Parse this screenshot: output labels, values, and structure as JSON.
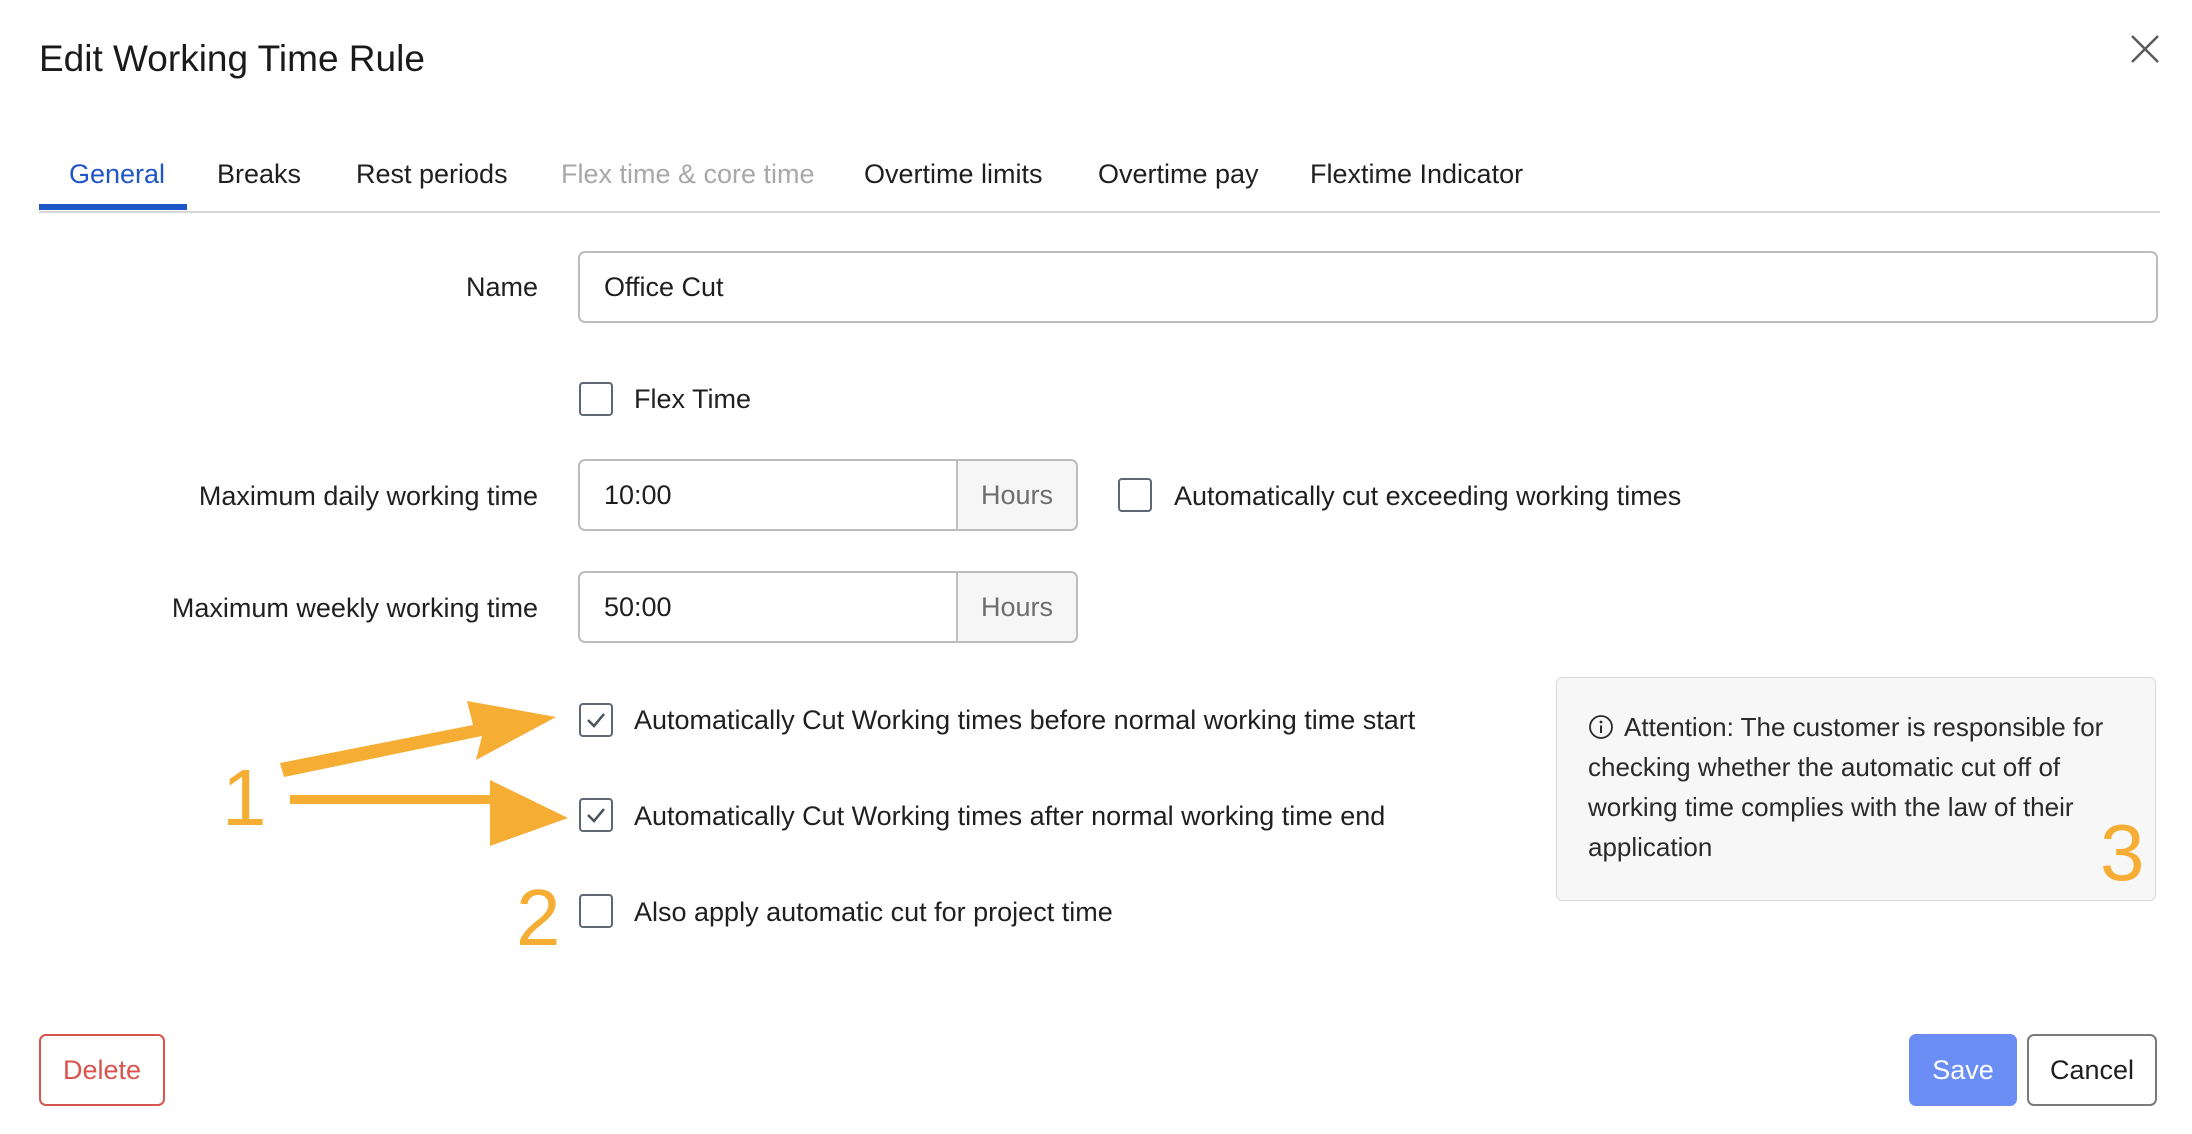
{
  "dialog": {
    "title": "Edit Working Time Rule"
  },
  "tabs": [
    {
      "label": "General",
      "state": "active"
    },
    {
      "label": "Breaks",
      "state": "normal"
    },
    {
      "label": "Rest periods",
      "state": "normal"
    },
    {
      "label": "Flex time & core time",
      "state": "disabled"
    },
    {
      "label": "Overtime limits",
      "state": "normal"
    },
    {
      "label": "Overtime pay",
      "state": "normal"
    },
    {
      "label": "Flextime Indicator",
      "state": "normal"
    }
  ],
  "form": {
    "name_label": "Name",
    "name_value": "Office Cut",
    "flex_time_label": "Flex Time",
    "flex_time_checked": false,
    "max_daily_label": "Maximum daily working time",
    "max_daily_value": "10:00",
    "max_daily_unit": "Hours",
    "auto_cut_exceeding_label": "Automatically cut exceeding working times",
    "auto_cut_exceeding_checked": false,
    "max_weekly_label": "Maximum weekly working time",
    "max_weekly_value": "50:00",
    "max_weekly_unit": "Hours",
    "cut_before_label": "Automatically Cut Working times before normal working time start",
    "cut_before_checked": true,
    "cut_after_label": "Automatically Cut Working times after normal working time end",
    "cut_after_checked": true,
    "project_time_label": "Also apply automatic cut for project time",
    "project_time_checked": false
  },
  "notice": {
    "icon": "info-icon",
    "text": "Attention: The customer is responsible for checking whether the automatic cut off of working time complies with the law of their application"
  },
  "buttons": {
    "delete": "Delete",
    "save": "Save",
    "cancel": "Cancel"
  },
  "annotations": {
    "one": "1",
    "two": "2",
    "three": "3",
    "color": "#f5ad34"
  },
  "colors": {
    "accent": "#1f56c7",
    "save_button": "#6b8ef5",
    "delete": "#d9534f"
  }
}
